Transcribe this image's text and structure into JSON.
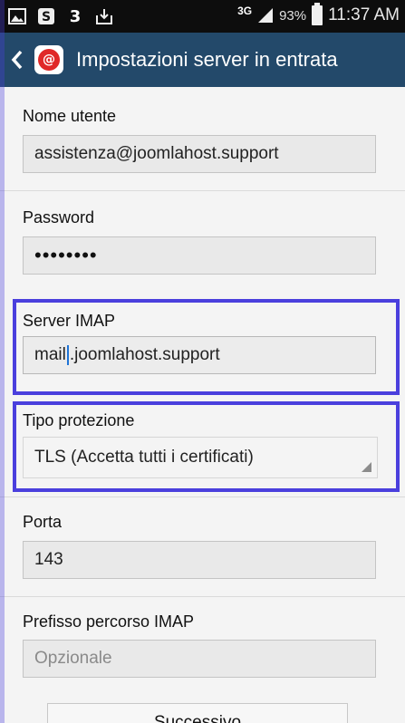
{
  "status_bar": {
    "network": "3G",
    "battery_percent": "93%",
    "time": "11:37 AM"
  },
  "action_bar": {
    "title": "Impostazioni server in entrata"
  },
  "form": {
    "username": {
      "label": "Nome utente",
      "value": "assistenza@joomlahost.support"
    },
    "password": {
      "label": "Password",
      "value": "••••••••"
    },
    "server": {
      "label": "Server IMAP",
      "value_before_cursor": "mail",
      "value_after_cursor": ".joomlahost.support"
    },
    "security": {
      "label": "Tipo protezione",
      "value": "TLS (Accetta tutti i certificati)"
    },
    "port": {
      "label": "Porta",
      "value": "143"
    },
    "prefix": {
      "label": "Prefisso percorso IMAP",
      "placeholder": "Opzionale"
    }
  },
  "next_button": {
    "label": "Successivo"
  }
}
